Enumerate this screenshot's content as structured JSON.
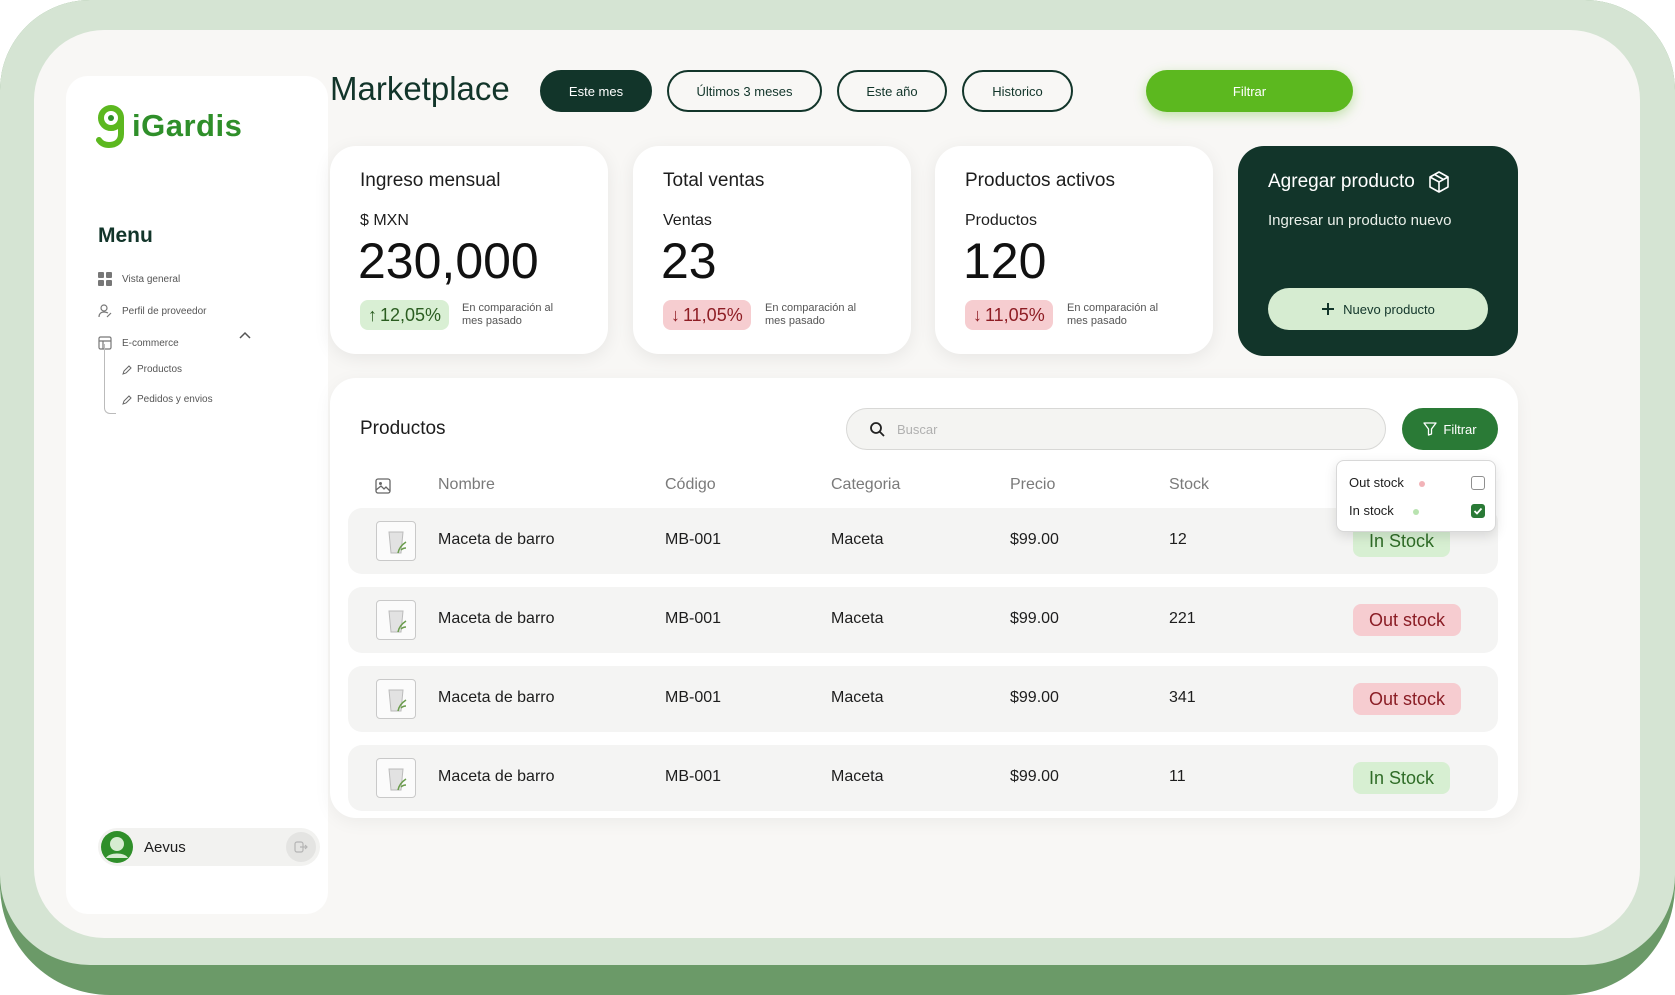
{
  "app": {
    "logo_text": "iGardis"
  },
  "sidebar": {
    "menu_title": "Menu",
    "items": [
      {
        "label": "Vista general",
        "icon": "grid-icon"
      },
      {
        "label": "Perfil de proveedor",
        "icon": "user-icon"
      },
      {
        "label": "E-commerce",
        "icon": "store-icon"
      }
    ],
    "subitems": [
      {
        "label": "Productos",
        "icon": "pencil-icon"
      },
      {
        "label": "Pedidos y envios",
        "icon": "pencil-icon"
      }
    ],
    "user": {
      "name": "Aevus"
    }
  },
  "header": {
    "title": "Marketplace",
    "periods": [
      "Este mes",
      "Últimos 3 meses",
      "Este año",
      "Historico"
    ],
    "active_period": "Este mes",
    "filter_label": "Filtrar"
  },
  "stats": [
    {
      "title": "Ingreso mensual",
      "sub": "$ MXN",
      "value": "230,000",
      "change": "12,05%",
      "direction": "up",
      "compare": "En comparación al mes pasado"
    },
    {
      "title": "Total ventas",
      "sub": "Ventas",
      "value": "23",
      "change": "11,05%",
      "direction": "down",
      "compare": "En comparación al mes pasado"
    },
    {
      "title": "Productos activos",
      "sub": "Productos",
      "value": "120",
      "change": "11,05%",
      "direction": "down",
      "compare": "En comparación al mes pasado"
    }
  ],
  "add_card": {
    "title": "Agregar producto",
    "subtitle": "Ingresar un producto nuevo",
    "button_label": "Nuevo producto"
  },
  "products": {
    "title": "Productos",
    "search_placeholder": "Buscar",
    "filter_label": "Filtrar",
    "columns": [
      "Nombre",
      "Código",
      "Categoria",
      "Precio",
      "Stock"
    ],
    "rows": [
      {
        "name": "Maceta de barro",
        "code": "MB-001",
        "category": "Maceta",
        "price": "$99.00",
        "stock": "12",
        "status": "In Stock"
      },
      {
        "name": "Maceta de barro",
        "code": "MB-001",
        "category": "Maceta",
        "price": "$99.00",
        "stock": "221",
        "status": "Out stock"
      },
      {
        "name": "Maceta de barro",
        "code": "MB-001",
        "category": "Maceta",
        "price": "$99.00",
        "stock": "341",
        "status": "Out stock"
      },
      {
        "name": "Maceta de barro",
        "code": "MB-001",
        "category": "Maceta",
        "price": "$99.00",
        "stock": "11",
        "status": "In Stock"
      }
    ],
    "filter_dropdown": [
      {
        "label": "Out stock",
        "checked": false,
        "dot_color": "#f2b3b8"
      },
      {
        "label": "In stock",
        "checked": true,
        "dot_color": "#b9e3b0"
      }
    ]
  },
  "colors": {
    "dark_green": "#12352a",
    "accent_green": "#5cb81f",
    "filter_green": "#2a7a36",
    "in_stock_bg": "#d7efd2",
    "out_stock_bg": "#f6ccd0"
  }
}
